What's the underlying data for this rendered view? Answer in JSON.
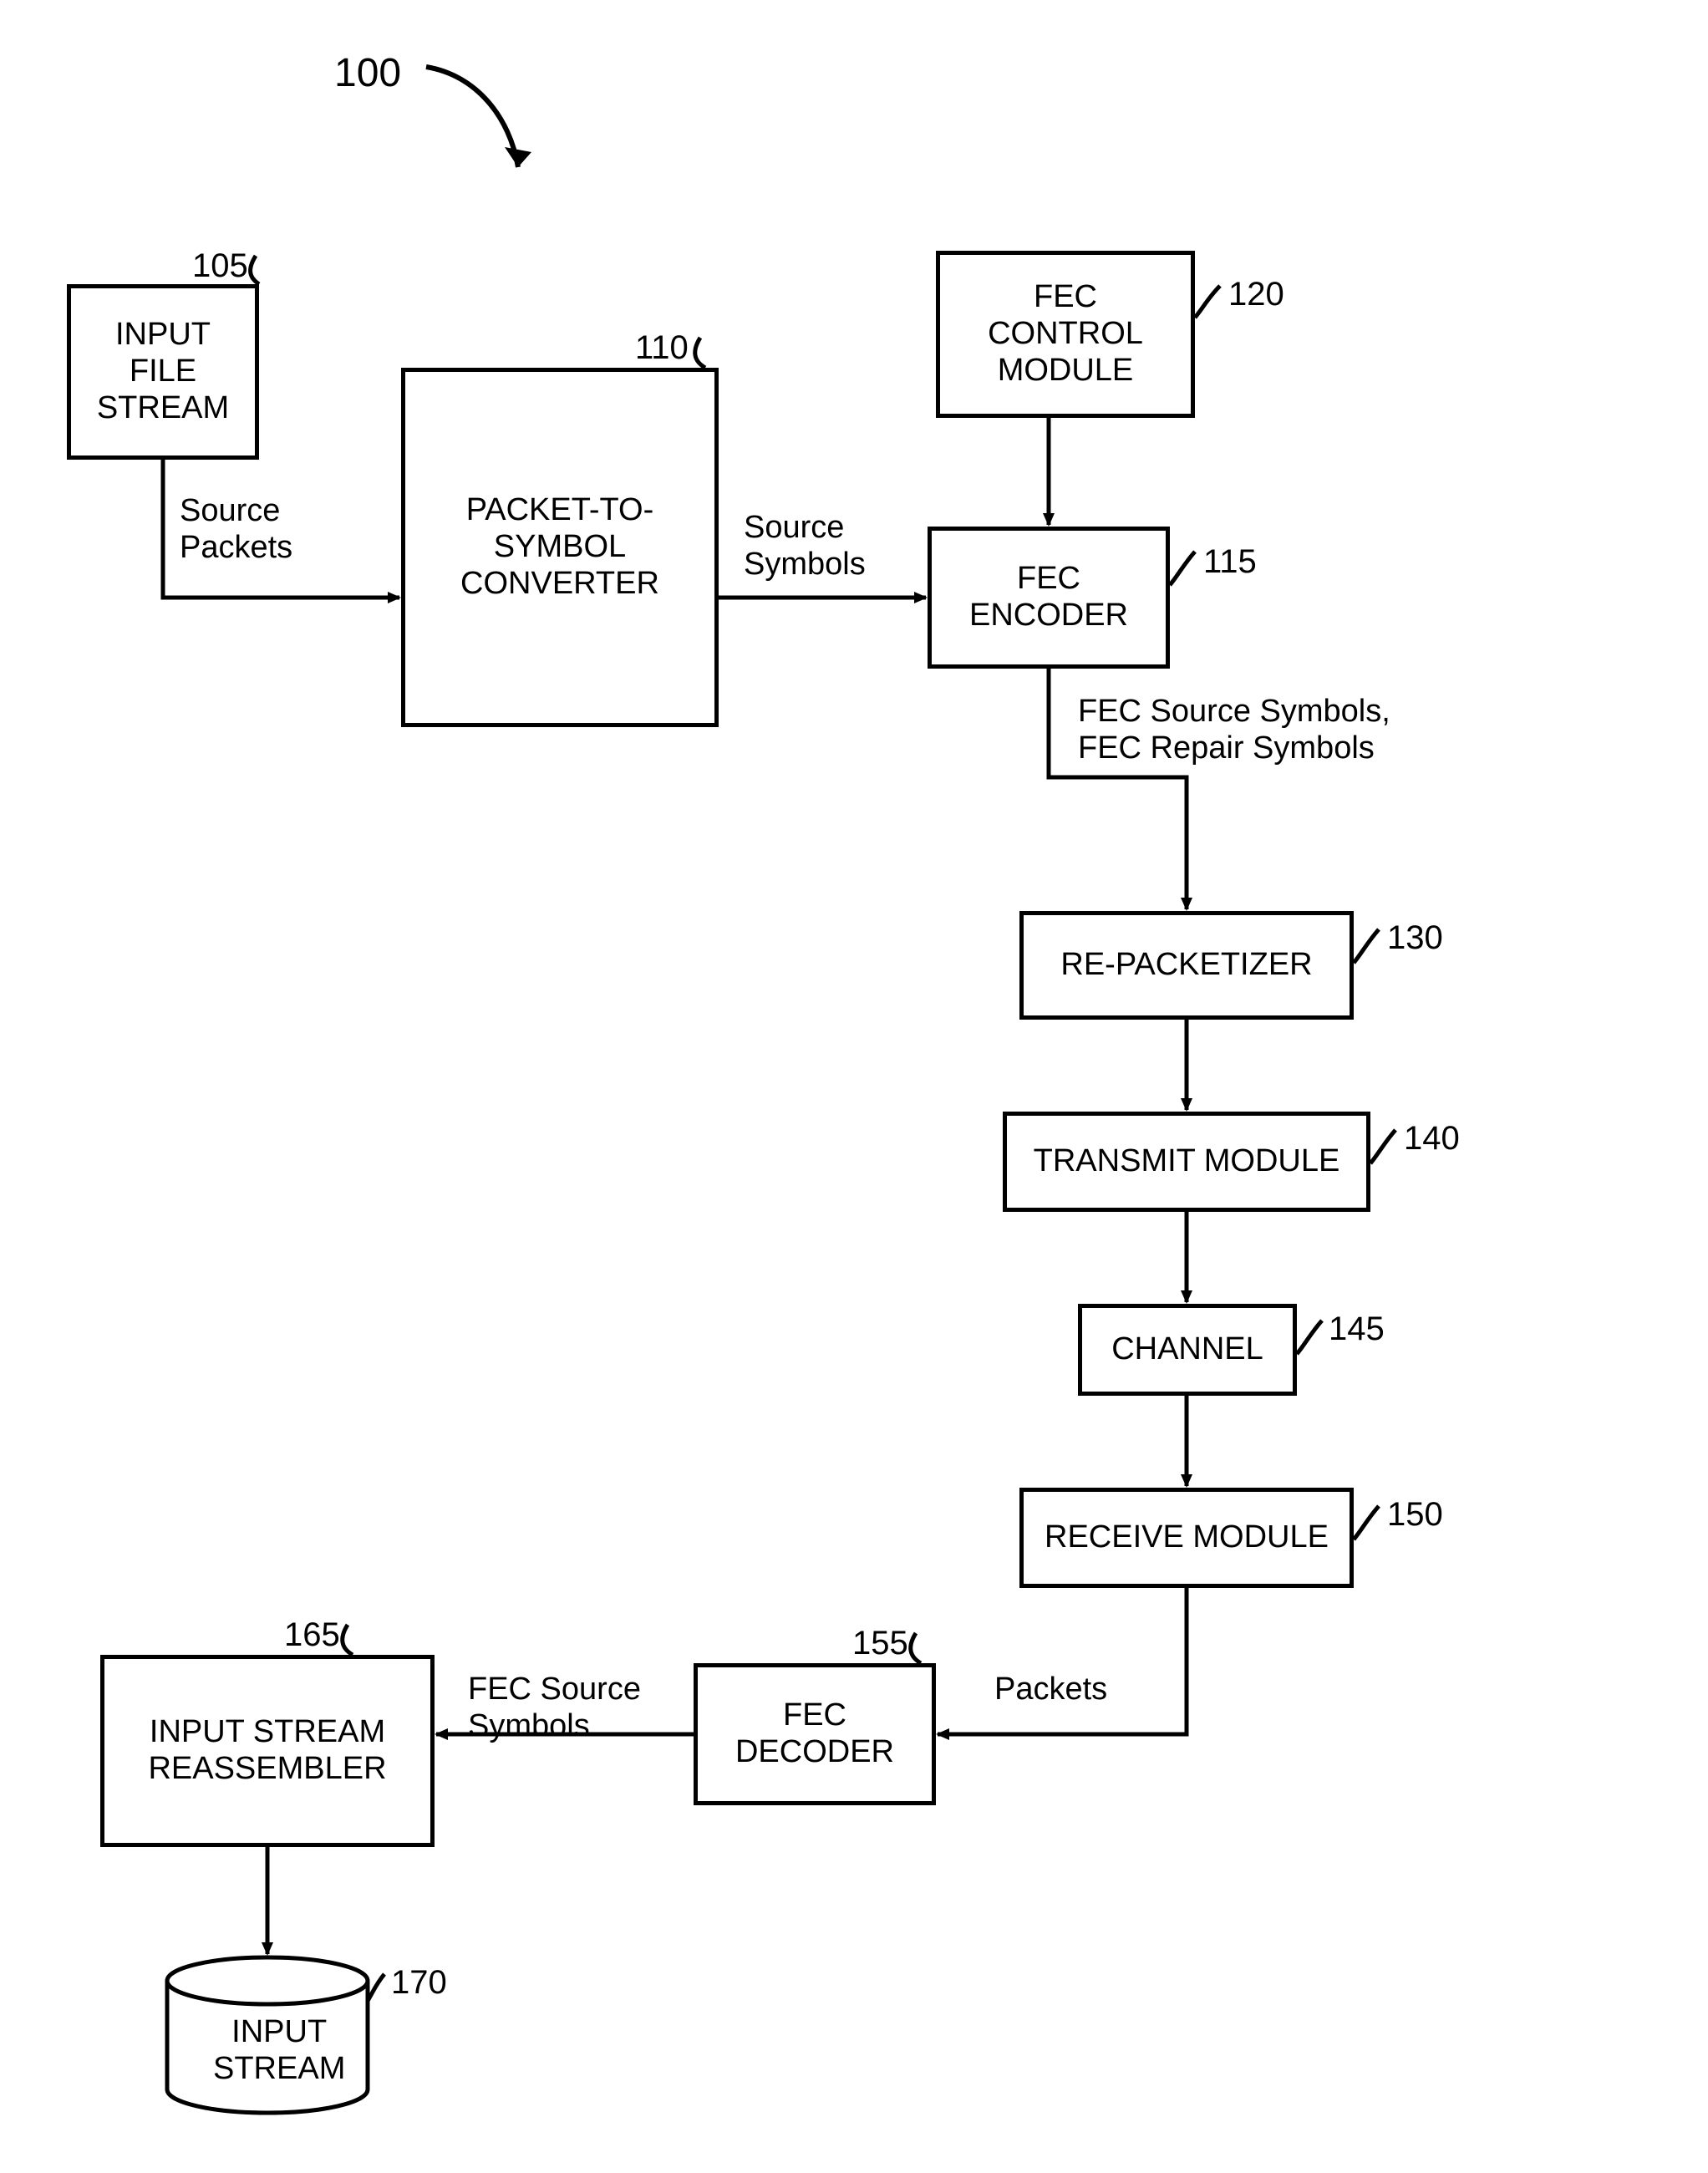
{
  "figure_ref": "100",
  "blocks": {
    "input_file_stream": {
      "label": "INPUT\nFILE\nSTREAM",
      "ref": "105"
    },
    "packet_to_symbol_converter": {
      "label": "PACKET-TO-\nSYMBOL\nCONVERTER",
      "ref": "110"
    },
    "fec_encoder": {
      "label": "FEC\nENCODER",
      "ref": "115"
    },
    "fec_control_module": {
      "label": "FEC\nCONTROL\nMODULE",
      "ref": "120"
    },
    "re_packetizer": {
      "label": "RE-PACKETIZER",
      "ref": "130"
    },
    "transmit_module": {
      "label": "TRANSMIT MODULE",
      "ref": "140"
    },
    "channel": {
      "label": "CHANNEL",
      "ref": "145"
    },
    "receive_module": {
      "label": "RECEIVE MODULE",
      "ref": "150"
    },
    "fec_decoder": {
      "label": "FEC\nDECODER",
      "ref": "155"
    },
    "input_stream_reassembler": {
      "label": "INPUT STREAM\nREASSEMBLER",
      "ref": "165"
    },
    "input_stream": {
      "label": "INPUT\nSTREAM",
      "ref": "170"
    }
  },
  "edges": {
    "source_packets": "Source\nPackets",
    "source_symbols": "Source\nSymbols",
    "fec_symbols": "FEC Source Symbols,\nFEC Repair Symbols",
    "packets": "Packets",
    "fec_source_symbols": "FEC Source\nSymbols"
  }
}
